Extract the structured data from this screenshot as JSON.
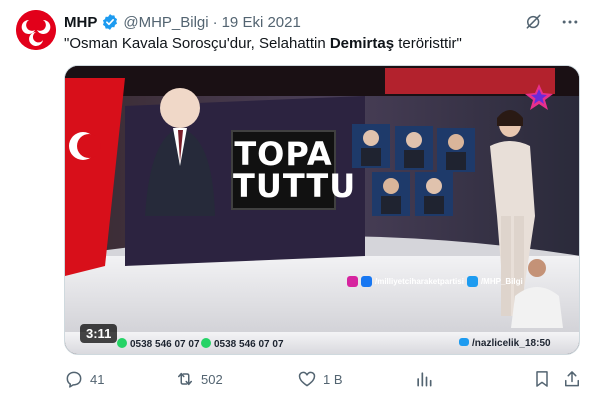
{
  "tweet": {
    "author_name": "MHP",
    "handle": "@MHP_Bilgi",
    "separator": "·",
    "date": "19 Eki 2021",
    "text_part1": "\"Osman Kavala Sorosçu'dur, Selahattin ",
    "text_bold": "Demirtaş",
    "text_part2": " teröristtir\""
  },
  "media": {
    "duration": "3:11",
    "headline_line1": "TOPA",
    "headline_line2": "TUTTU",
    "social_text": "/milliyetciharaketpartisi",
    "social_handle": "/MHP_Bilgi",
    "ticker_phone1": "0538 546 07 07",
    "ticker_phone2": "0538 546 07 07",
    "ticker_handle": "/nazlicelik_",
    "ticker_clock": "18:50"
  },
  "actions": {
    "replies": "41",
    "retweets": "502",
    "likes": "1 B"
  },
  "colors": {
    "verified": "#1d9bf0",
    "brand_red": "#e2001a",
    "muted_text": "#536471"
  }
}
